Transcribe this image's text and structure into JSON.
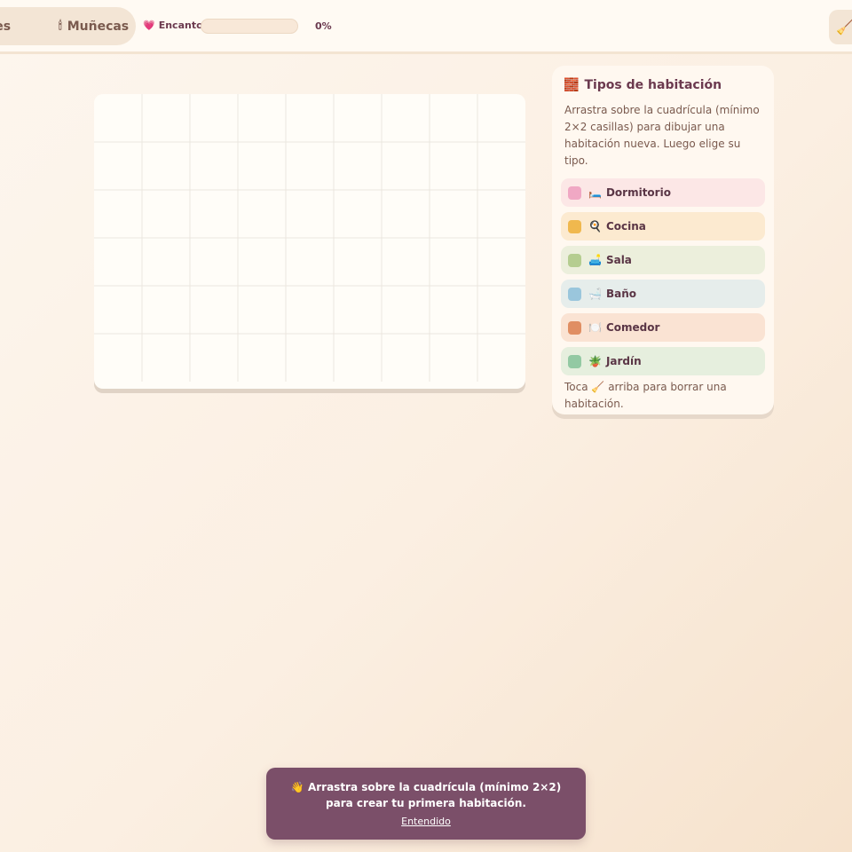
{
  "topbar": {
    "tabs": [
      {
        "label": "uebles",
        "icon": ""
      },
      {
        "label": "Muñecas",
        "icon": "🕯"
      }
    ],
    "encanto_label": "Encanto",
    "encanto_icon": "💗",
    "progress_percent": 0,
    "progress_text": "0%",
    "right_button_icon": "🧹"
  },
  "panel": {
    "title_icon": "🧱",
    "title": "Tipos de habitación",
    "description": "Arrastra sobre la cuadrícula (mínimo 2×2 casillas) para dibujar una habitación nueva. Luego elige su tipo.",
    "rooms": [
      {
        "icon": "🛏️",
        "label": "Dormitorio",
        "swatch": "#f0a8c4",
        "bg": "#fce7e6"
      },
      {
        "icon": "🍳",
        "label": "Cocina",
        "swatch": "#f0b84e",
        "bg": "#fcead0"
      },
      {
        "icon": "🛋️",
        "label": "Sala",
        "swatch": "#b5cd90",
        "bg": "#ecefdc"
      },
      {
        "icon": "🛁",
        "label": "Baño",
        "swatch": "#9ac6dc",
        "bg": "#e6edeb"
      },
      {
        "icon": "🍽️",
        "label": "Comedor",
        "swatch": "#e08e63",
        "bg": "#fae3d3"
      },
      {
        "icon": "🪴",
        "label": "Jardín",
        "swatch": "#93c9a3",
        "bg": "#e6efde"
      }
    ],
    "foot_before": "Toca",
    "foot_icon": "🧹",
    "foot_after": "arriba para borrar una habitación."
  },
  "toast": {
    "icon": "👋",
    "message": "Arrastra sobre la cuadrícula (mínimo 2×2) para crear tu primera habitación.",
    "link": "Entendido"
  },
  "colors": {
    "accent": "#7b4f69",
    "background": "#fdf6ee"
  }
}
